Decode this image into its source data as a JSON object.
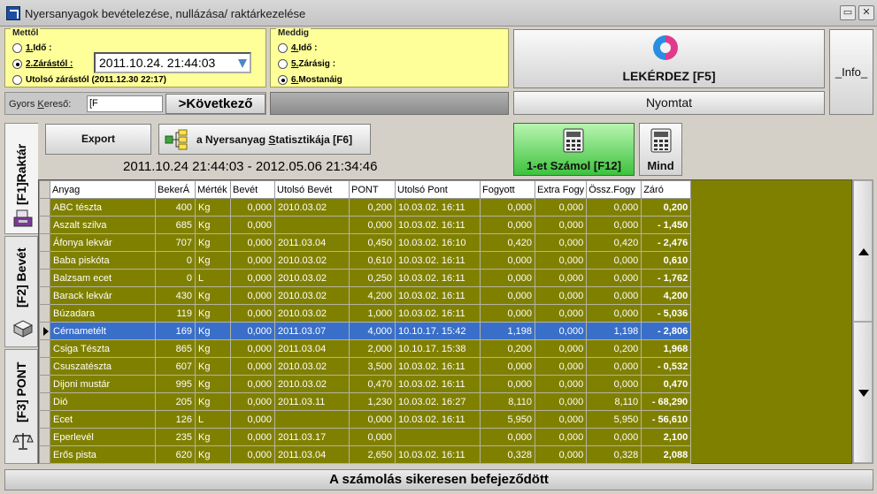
{
  "window": {
    "title": "Nyersanyagok bevételezése, nullázása/ raktárkezelése",
    "restore_glyph": "▭",
    "close_glyph": "✕"
  },
  "from_group": {
    "legend": "Mettől",
    "opt1_key": "1.",
    "opt1_rest": "Idő :",
    "opt2_key": "2.",
    "opt2_rest": "Zárástól :",
    "opt2_selected": true,
    "opt3_label": "Utolsó zárástól (2011.12.30 22:17)",
    "date_value": "2011.10.24. 21:44:03"
  },
  "to_group": {
    "legend": "Meddig",
    "opt4_key": "4.",
    "opt4_rest": "Idő :",
    "opt5_key": "5.",
    "opt5_rest": "Zárásig :",
    "opt6_key": "6.",
    "opt6_rest": "Mostanáig",
    "opt6_selected": true
  },
  "search": {
    "label_pre": "Gyors ",
    "label_key": "K",
    "label_post": "ereső:",
    "input_value": "[F",
    "next_label": ">Következő"
  },
  "buttons": {
    "query": "LEKÉRDEZ [F5]",
    "info": "_Info_",
    "print": "Nyomtat",
    "export": "Export",
    "stats_pre": "a Nyersanyag ",
    "stats_key": "S",
    "stats_post": "tatisztikája [F6]",
    "count_one": "1-et Számol [F12]",
    "all": "Mind"
  },
  "range_text": "2011.10.24 21:44:03 - 2012.05.06 21:34:46",
  "tabs": [
    {
      "label": "[F1]Raktár",
      "active": true
    },
    {
      "label": "[F2] Bevét",
      "active": false
    },
    {
      "label": "[F3] PONT",
      "active": false
    }
  ],
  "table": {
    "columns": [
      "Anyag",
      "BekerÁ",
      "Mérték",
      "Bevét",
      "Utolsó Bevét",
      "PONT",
      "Utolsó Pont",
      "Fogyott",
      "Extra Fogy",
      "Össz.Fogy",
      "Záró"
    ],
    "selected_row": 7,
    "rows": [
      [
        "ABC tészta",
        "400",
        "Kg",
        "0,000",
        "2010.03.02",
        "0,200",
        "10.03.02. 16:11",
        "0,000",
        "0,000",
        "0,000",
        "0,200"
      ],
      [
        "Aszalt szilva",
        "685",
        "Kg",
        "0,000",
        "",
        "0,000",
        "10.03.02. 16:11",
        "0,000",
        "0,000",
        "0,000",
        "- 1,450"
      ],
      [
        "Áfonya lekvár",
        "707",
        "Kg",
        "0,000",
        "2011.03.04",
        "0,450",
        "10.03.02. 16:10",
        "0,420",
        "0,000",
        "0,420",
        "- 2,476"
      ],
      [
        "Baba piskóta",
        "0",
        "Kg",
        "0,000",
        "2010.03.02",
        "0,610",
        "10.03.02. 16:11",
        "0,000",
        "0,000",
        "0,000",
        "0,610"
      ],
      [
        "Balzsam ecet",
        "0",
        "L",
        "0,000",
        "2010.03.02",
        "0,250",
        "10.03.02. 16:11",
        "0,000",
        "0,000",
        "0,000",
        "- 1,762"
      ],
      [
        "Barack lekvár",
        "430",
        "Kg",
        "0,000",
        "2010.03.02",
        "4,200",
        "10.03.02. 16:11",
        "0,000",
        "0,000",
        "0,000",
        "4,200"
      ],
      [
        "Búzadara",
        "119",
        "Kg",
        "0,000",
        "2010.03.02",
        "1,000",
        "10.03.02. 16:11",
        "0,000",
        "0,000",
        "0,000",
        "- 5,036"
      ],
      [
        "Cérnametélt",
        "169",
        "Kg",
        "0,000",
        "2011.03.07",
        "4,000",
        "10.10.17. 15:42",
        "1,198",
        "0,000",
        "1,198",
        "- 2,806"
      ],
      [
        "Csiga Tészta",
        "865",
        "Kg",
        "0,000",
        "2011.03.04",
        "2,000",
        "10.10.17. 15:38",
        "0,200",
        "0,000",
        "0,200",
        "1,968"
      ],
      [
        "Csuszatészta",
        "607",
        "Kg",
        "0,000",
        "2010.03.02",
        "3,500",
        "10.03.02. 16:11",
        "0,000",
        "0,000",
        "0,000",
        "- 0,532"
      ],
      [
        "Dijoni mustár",
        "995",
        "Kg",
        "0,000",
        "2010.03.02",
        "0,470",
        "10.03.02. 16:11",
        "0,000",
        "0,000",
        "0,000",
        "0,470"
      ],
      [
        "Dió",
        "205",
        "Kg",
        "0,000",
        "2011.03.11",
        "1,230",
        "10.03.02. 16:27",
        "8,110",
        "0,000",
        "8,110",
        "- 68,290"
      ],
      [
        "Ecet",
        "126",
        "L",
        "0,000",
        "",
        "0,000",
        "10.03.02. 16:11",
        "5,950",
        "0,000",
        "5,950",
        "- 56,610"
      ],
      [
        "Eperlevél",
        "235",
        "Kg",
        "0,000",
        "2011.03.17",
        "0,000",
        "",
        "0,000",
        "0,000",
        "0,000",
        "2,100"
      ],
      [
        "Erős pista",
        "620",
        "Kg",
        "0,000",
        "2011.03.04",
        "2,650",
        "10.03.02. 16:11",
        "0,328",
        "0,000",
        "0,328",
        "2,088"
      ]
    ]
  },
  "status": "A számolás sikeresen befejeződött",
  "icons": {
    "app": "app-icon",
    "query": "refresh-arrows-icon",
    "stats": "tree-chart-icon",
    "calc": "calculator-icon",
    "stock_tab": "register-icon",
    "income_tab": "box-icon",
    "point_tab": "scales-icon"
  },
  "colors": {
    "grid_bg": "#808000",
    "selected_row": "#3a6fc9",
    "yellow_panel": "#ffff99",
    "count_button": "#44cc44"
  }
}
